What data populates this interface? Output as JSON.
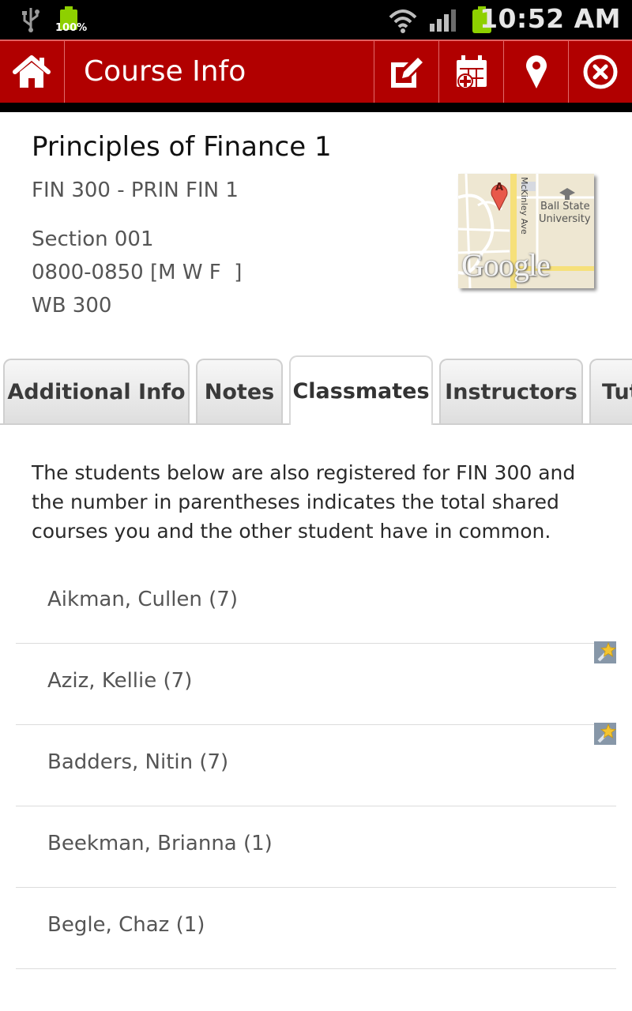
{
  "status_bar": {
    "battery_small": "100%",
    "time": "10:52 AM"
  },
  "action_bar": {
    "title": "Course Info",
    "buttons": [
      "home-icon",
      "edit-note-icon",
      "add-calendar-icon",
      "location-pin-icon",
      "close-icon"
    ],
    "accent": "#b10000"
  },
  "course": {
    "title": "Principles of Finance 1",
    "code": "FIN 300 - PRIN FIN 1",
    "section": "Section 001",
    "time": "0800-0850 [M W F  ]",
    "room": "WB 300"
  },
  "map": {
    "street": "McKinley Ave",
    "place_line1": "Ball State",
    "place_line2": "University",
    "marker": "A",
    "brand": "Google"
  },
  "tabs": [
    {
      "label": "Additional Info"
    },
    {
      "label": "Notes"
    },
    {
      "label": "Classmates",
      "active": true
    },
    {
      "label": "Instructors"
    },
    {
      "label": "Tut"
    }
  ],
  "classmates": {
    "description": "The students below are also registered for FIN 300 and the number in parentheses indicates the total shared courses you and the other student have in common.",
    "items": [
      {
        "name": "Aikman, Cullen (7)"
      },
      {
        "name": "Aziz, Kellie (7)",
        "starred": true
      },
      {
        "name": "Badders, Nitin (7)",
        "starred": true
      },
      {
        "name": "Beekman, Brianna (1)"
      },
      {
        "name": "Begle, Chaz (1)"
      }
    ]
  }
}
